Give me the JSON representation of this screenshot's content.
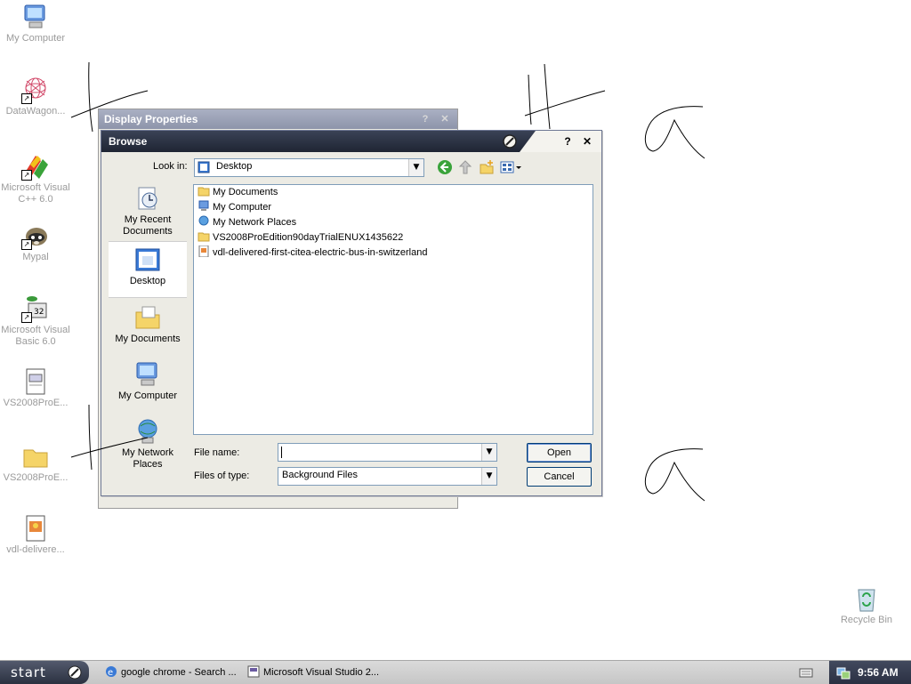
{
  "desktop": {
    "icons": [
      {
        "label": "My Computer"
      },
      {
        "label": "DataWagon..."
      },
      {
        "label": "Microsoft Visual C++ 6.0"
      },
      {
        "label": "Mypal"
      },
      {
        "label": "Microsoft Visual Basic 6.0"
      },
      {
        "label": "VS2008ProE..."
      },
      {
        "label": "VS2008ProE..."
      },
      {
        "label": "vdl-delivere..."
      },
      {
        "label": "Recycle Bin"
      }
    ]
  },
  "display_properties": {
    "title": "Display Properties",
    "help": "?",
    "close": "✕"
  },
  "browse": {
    "title": "Browse",
    "help": "?",
    "close": "✕",
    "look_in_label": "Look in:",
    "look_in_value": "Desktop",
    "places": [
      {
        "label": "My Recent Documents"
      },
      {
        "label": "Desktop"
      },
      {
        "label": "My Documents"
      },
      {
        "label": "My Computer"
      },
      {
        "label": "My Network Places"
      }
    ],
    "files": [
      {
        "name": "My Documents"
      },
      {
        "name": "My Computer"
      },
      {
        "name": "My Network Places"
      },
      {
        "name": "VS2008ProEdition90dayTrialENUX1435622"
      },
      {
        "name": "vdl-delivered-first-citea-electric-bus-in-switzerland"
      }
    ],
    "file_name_label": "File name:",
    "file_name_value": "",
    "files_of_type_label": "Files of type:",
    "files_of_type_value": "Background Files",
    "open_label": "Open",
    "cancel_label": "Cancel"
  },
  "taskbar": {
    "start_label": "start",
    "tasks": [
      {
        "label": "google chrome - Search ..."
      },
      {
        "label": "Microsoft Visual Studio 2..."
      }
    ],
    "clock": "9:56 AM"
  },
  "colors": {
    "title_dark": "#1f2533",
    "title_inactive": "#8d94aa",
    "dialog_bg": "#ecebe4",
    "desktop_bg": "#ffffff"
  }
}
